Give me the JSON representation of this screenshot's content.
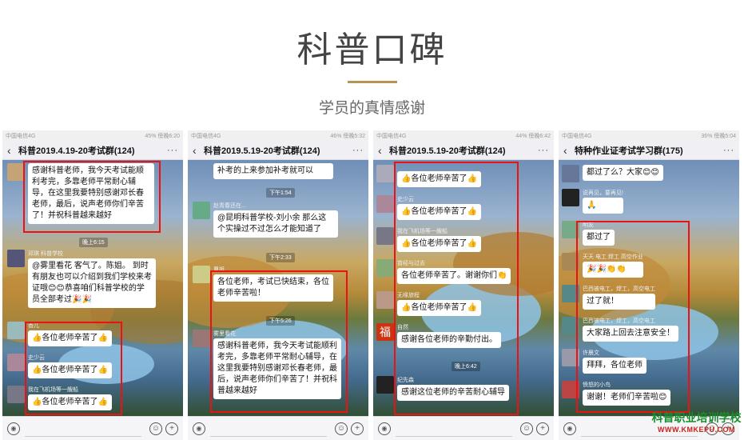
{
  "page": {
    "title": "科普口碑",
    "subtitle": "学员的真情感谢"
  },
  "phones": [
    {
      "carrier": "中国电信4G",
      "status_right": "45% 傍晚6:20",
      "chat_title": "科普2019.4.19-20考试群(124)",
      "messages": {
        "m1": "感谢科普老师，我今天考试能顺利考完，多靠老师平常耐心辅导，在这里我要特别感谢邓长春老师，最后，说声老师你们辛苦了！并祝科普越来越好",
        "ts1": "晚上6:15",
        "n2": "邓琪 科普学校",
        "m2": "@雾里看花  客气了。陈姐。 到时有朋友也可以介绍到我们学校来考证哦😊😊恭喜咱们科普学校的学员全部考过🎉🎉",
        "n3": "香儿",
        "m3": "👍各位老师辛苦了👍",
        "n4": "史少云",
        "m4": "👍各位老师辛苦了👍",
        "n5": "我在飞机场等一艘船",
        "m5": "👍各位老师辛苦了👍"
      }
    },
    {
      "carrier": "中国电信4G",
      "status_right": "46% 傍晚5:32",
      "chat_title": "科普2019.5.19-20考试群(124)",
      "messages": {
        "m1": "补考的上来参加补考就可以",
        "ts1": "下午1:54",
        "n2": "赵青春还在...",
        "m2": "@昆明科普学校-刘小余  那么这个实操过不过怎么才能知道了",
        "ts2": "下午2:33",
        "n3": "曹姐",
        "m3": "各位老师，考试已快结束，各位老师辛苦啦！",
        "ts3": "下午5:26",
        "n4": "雾里看花",
        "m4": "感谢科普老师，我今天考试能顺利考完，多靠老师平常耐心辅导，在这里我要特别感谢邓长春老师，最后，说声老师你们辛苦了！并祝科普越来越好"
      }
    },
    {
      "carrier": "中国电信4G",
      "status_right": "44% 傍晚6:42",
      "chat_title": "科普2019.5.19-20考试群(124)",
      "messages": {
        "m1": "👍各位老师辛苦了👍",
        "n2": "史少云",
        "m2": "👍各位老师辛苦了👍",
        "n3": "我在飞机场等一艘船",
        "m3": "👍各位老师辛苦了👍",
        "n4": "曾经与过去",
        "m4": "各位老师辛苦了。谢谢你们👏",
        "n5": "无缘旅程",
        "m5": "👍各位老师辛苦了👍",
        "n6": "自然",
        "m6": "感谢各位老师的辛勤付出。",
        "ts1": "晚上6:42",
        "n7": "纪先森",
        "m7": "感谢这位老师的辛苦耐心辅导"
      }
    },
    {
      "carrier": "中国电信4G",
      "status_right": "36% 傍晚5:04",
      "chat_title": "特种作业证考试学习群(175)",
      "messages": {
        "m1": "都过了么？大家😊😊",
        "n2": "说再见，要再见!",
        "m2": "🙏",
        "n3": "明友",
        "m3": "都过了",
        "n4": "天天 电工 焊工 高空作业",
        "m4": "🎉🎉👏👏",
        "n5": "巴西被电工，焊工，高空电工",
        "m5": "过了就！",
        "n6": "巴西被电工，焊工，高空电工",
        "m6": "大家路上回去注意安全！",
        "n7": "许晨文",
        "m7": "拜拜，各位老师",
        "n8": "愤怒的小鸟",
        "m8": "谢谢！老师们辛苦啦😊"
      }
    }
  ],
  "watermark": {
    "title": "科普职业培训学校",
    "url": "WWW.KMKEPU.COM"
  }
}
